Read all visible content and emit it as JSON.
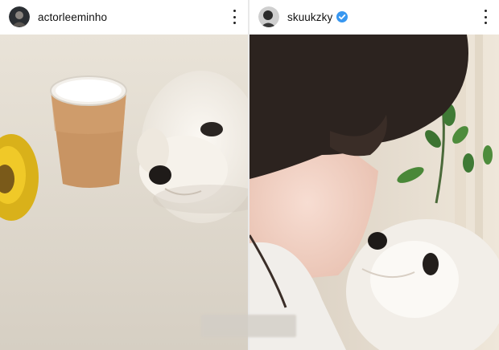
{
  "left_post": {
    "username": "actorleeminho",
    "menu_icon": "more-vertical-icon",
    "avatar_icon": "profile-avatar-icon"
  },
  "right_post": {
    "username": "skuukzky",
    "verified_icon": "verified-badge-icon",
    "verified_color": "#3897f0",
    "menu_icon": "more-vertical-icon",
    "avatar_icon": "profile-avatar-icon"
  },
  "colors": {
    "background": "#ffffff",
    "text": "#111111",
    "divider": "#e9e9e9"
  }
}
